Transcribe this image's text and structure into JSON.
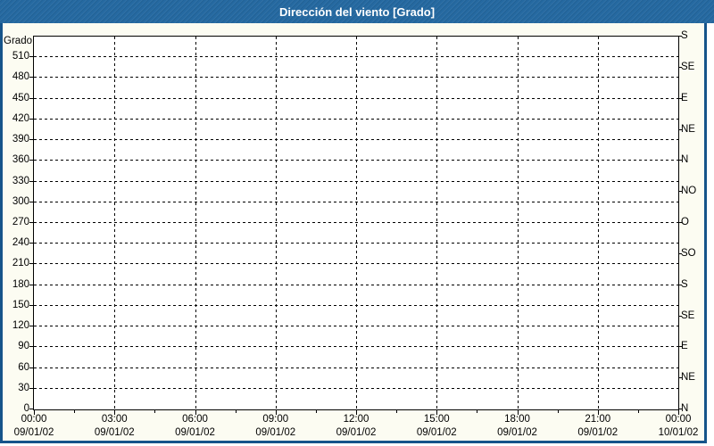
{
  "window": {
    "title": "Dirección del viento [Grado]"
  },
  "colors": {
    "titlebar_bg": "#2569a1",
    "titlebar_text": "#ffffff",
    "frame_border": "#16548a",
    "window_bg": "#fcfcf2",
    "plot_bg": "#ffffff",
    "grid": "#000000",
    "label_text": "#000000"
  },
  "chart_data": {
    "type": "line",
    "title": "Dirección del viento [Grado]",
    "ylabel": "Grado",
    "ylim": [
      0,
      540
    ],
    "y_tick_step": 30,
    "y_left_ticks": [
      0,
      30,
      60,
      90,
      120,
      150,
      180,
      210,
      240,
      270,
      300,
      330,
      360,
      390,
      420,
      450,
      480,
      510
    ],
    "y_right_compass": [
      {
        "deg": 540,
        "label": "S"
      },
      {
        "deg": 495,
        "label": "SE"
      },
      {
        "deg": 450,
        "label": "E"
      },
      {
        "deg": 405,
        "label": "NE"
      },
      {
        "deg": 360,
        "label": "N"
      },
      {
        "deg": 315,
        "label": "NO"
      },
      {
        "deg": 270,
        "label": "O"
      },
      {
        "deg": 225,
        "label": "SO"
      },
      {
        "deg": 180,
        "label": "S"
      },
      {
        "deg": 135,
        "label": "SE"
      },
      {
        "deg": 90,
        "label": "E"
      },
      {
        "deg": 45,
        "label": "NE"
      },
      {
        "deg": 0,
        "label": "N"
      }
    ],
    "x_range_hours": [
      0,
      24
    ],
    "x_ticks": [
      {
        "hour": 0,
        "time": "00:00",
        "date": "09/01/02"
      },
      {
        "hour": 3,
        "time": "03:00",
        "date": "09/01/02"
      },
      {
        "hour": 6,
        "time": "06:00",
        "date": "09/01/02"
      },
      {
        "hour": 9,
        "time": "09:00",
        "date": "09/01/02"
      },
      {
        "hour": 12,
        "time": "12:00",
        "date": "09/01/02"
      },
      {
        "hour": 15,
        "time": "15:00",
        "date": "09/01/02"
      },
      {
        "hour": 18,
        "time": "18:00",
        "date": "09/01/02"
      },
      {
        "hour": 21,
        "time": "21:00",
        "date": "09/01/02"
      },
      {
        "hour": 24,
        "time": "00:00",
        "date": "10/01/02"
      }
    ],
    "x_minor_tick_hours": [
      1.5,
      4.5,
      7.5,
      10.5,
      13.5,
      16.5,
      19.5,
      22.5
    ],
    "grid": "dashed",
    "legend": "none",
    "series": []
  }
}
